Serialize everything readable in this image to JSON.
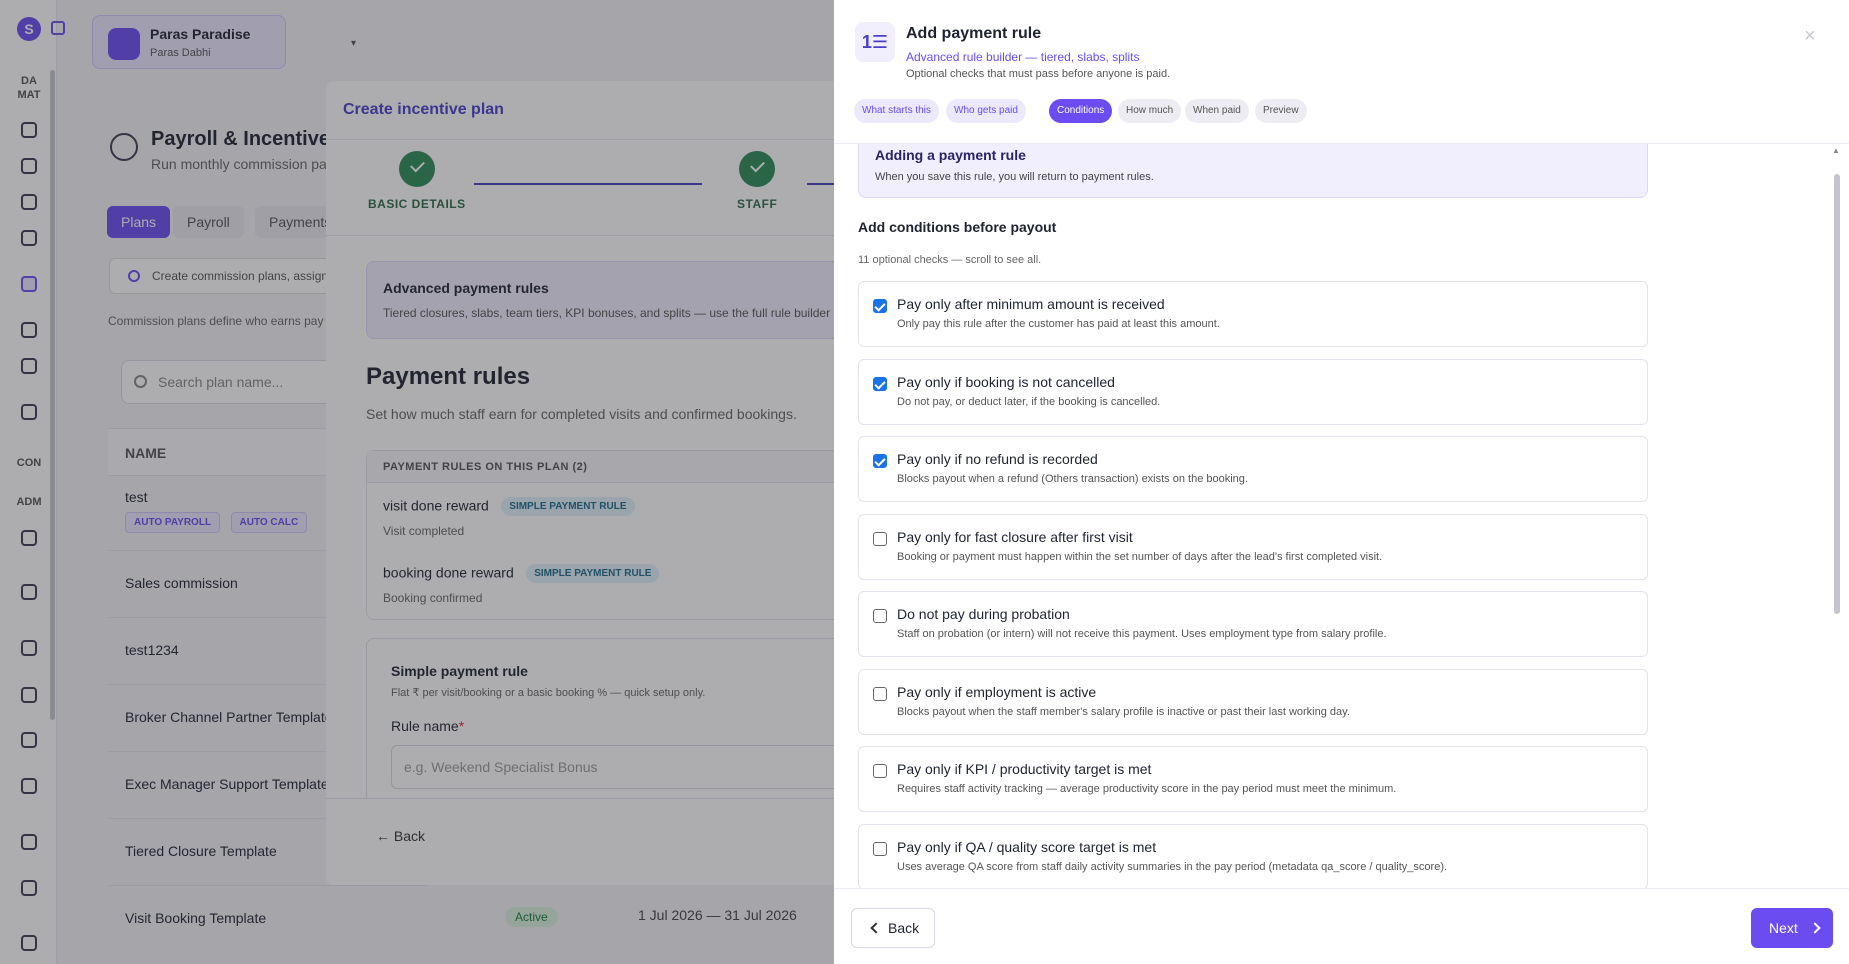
{
  "sidebar": {
    "logo": "S",
    "sections": [
      "DA MAT",
      "CON",
      "ADM"
    ]
  },
  "workspace": {
    "name": "Paras Paradise",
    "owner": "Paras Dabhi"
  },
  "page": {
    "title": "Payroll & Incentives",
    "subtitle": "Run monthly commission pa",
    "tabs": [
      "Plans",
      "Payroll",
      "Payments"
    ],
    "hint": "Create commission plans, assign",
    "info": "Commission plans define who earns pay",
    "search_placeholder": "Search plan name...",
    "table_header": "NAME",
    "plans": [
      "test",
      "Sales commission",
      "test1234",
      "Broker Channel Partner Template",
      "Exec Manager Support Template",
      "Tiered Closure Template",
      "Visit Booking Template"
    ],
    "plan_badges": [
      "AUTO PAYROLL",
      "AUTO CALC"
    ],
    "status": "Active",
    "dates": "1 Jul 2026 — 31 Jul 2026"
  },
  "modal": {
    "title": "Create incentive plan",
    "steps": [
      "BASIC DETAILS",
      "STAFF"
    ],
    "advanced": {
      "title": "Advanced payment rules",
      "desc": "Tiered closures, slabs, team tiers, KPI bonuses, and splits — use the full rule builder"
    },
    "rules_title": "Payment rules",
    "rules_sub": "Set how much staff earn for completed visits and confirmed bookings.",
    "rules_list_header": "PAYMENT RULES ON THIS PLAN (2)",
    "rules": [
      {
        "name": "visit done reward",
        "badge": "SIMPLE PAYMENT RULE",
        "sub": "Visit completed"
      },
      {
        "name": "booking done reward",
        "badge": "SIMPLE PAYMENT RULE",
        "sub": "Booking confirmed"
      }
    ],
    "simple": {
      "title": "Simple payment rule",
      "desc": "Flat ₹ per visit/booking or a basic booking % — quick setup only.",
      "field_label": "Rule name",
      "required_mark": "*",
      "placeholder": "e.g. Weekend Specialist Bonus"
    },
    "back": "Back"
  },
  "drawer": {
    "icon": "1☰",
    "title": "Add payment rule",
    "subtitle": "Advanced rule builder — tiered, slabs, splits",
    "desc": "Optional checks that must pass before anyone is paid.",
    "close": "×",
    "steps": [
      "What starts this",
      "Who gets paid",
      "Conditions",
      "How much",
      "When paid",
      "Preview"
    ],
    "note": {
      "title": "Adding a payment rule",
      "desc": "When you save this rule, you will return to payment rules."
    },
    "conditions_title": "Add conditions before payout",
    "conditions_sub": "11 optional checks — scroll to see all.",
    "conditions": [
      {
        "title": "Pay only after minimum amount is received",
        "desc": "Only pay this rule after the customer has paid at least this amount.",
        "checked": true
      },
      {
        "title": "Pay only if booking is not cancelled",
        "desc": "Do not pay, or deduct later, if the booking is cancelled.",
        "checked": true
      },
      {
        "title": "Pay only if no refund is recorded",
        "desc": "Blocks payout when a refund (Others transaction) exists on the booking.",
        "checked": true
      },
      {
        "title": "Pay only for fast closure after first visit",
        "desc": "Booking or payment must happen within the set number of days after the lead's first completed visit.",
        "checked": false
      },
      {
        "title": "Do not pay during probation",
        "desc": "Staff on probation (or intern) will not receive this payment. Uses employment type from salary profile.",
        "checked": false
      },
      {
        "title": "Pay only if employment is active",
        "desc": "Blocks payout when the staff member's salary profile is inactive or past their last working day.",
        "checked": false
      },
      {
        "title": "Pay only if KPI / productivity target is met",
        "desc": "Requires staff activity tracking — average productivity score in the pay period must meet the minimum.",
        "checked": false
      },
      {
        "title": "Pay only if QA / quality score target is met",
        "desc": "Uses average QA score from staff daily activity summaries in the pay period (metadata qa_score / quality_score).",
        "checked": false
      }
    ],
    "back": "Back",
    "next": "Next"
  }
}
